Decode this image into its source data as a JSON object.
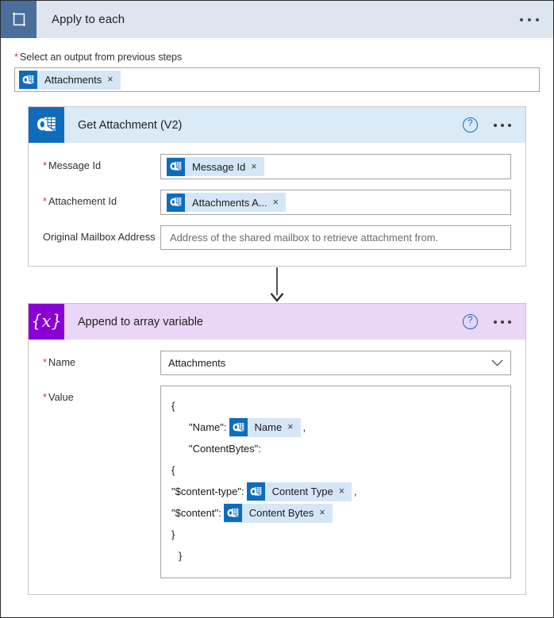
{
  "loop": {
    "title": "Apply to each",
    "icon": "loop-icon",
    "menu_icon": "ellipsis-icon",
    "output_field": {
      "label": "Select an output from previous steps",
      "required_marker": "*",
      "token": {
        "label": "Attachments",
        "icon": "outlook-icon",
        "remove": "×"
      }
    }
  },
  "get_attachment_card": {
    "title": "Get Attachment (V2)",
    "icon": "outlook-icon",
    "help_label": "?",
    "menu_icon": "ellipsis-icon",
    "fields": [
      {
        "label": "Message Id",
        "required_marker": "*",
        "token": {
          "label": "Message Id",
          "icon": "outlook-icon",
          "remove": "×"
        }
      },
      {
        "label": "Attachement Id",
        "required_marker": "*",
        "token": {
          "label": "Attachments A...",
          "icon": "outlook-icon",
          "remove": "×"
        }
      },
      {
        "label": "Original Mailbox Address",
        "required_marker": "",
        "placeholder": "Address of the shared mailbox to retrieve attachment from.",
        "value": ""
      }
    ]
  },
  "connector": {
    "icon": "down-arrow-icon"
  },
  "append_card": {
    "title": "Append to array variable",
    "icon": "variable-icon",
    "icon_glyph": "{x}",
    "help_label": "?",
    "menu_icon": "ellipsis-icon",
    "name_field": {
      "label": "Name",
      "required_marker": "*",
      "value": "Attachments",
      "chevron_icon": "chevron-down-icon"
    },
    "value_field": {
      "label": "Value",
      "required_marker": "*",
      "lines": [
        {
          "indent": 0,
          "before": "{",
          "token": null,
          "after": ""
        },
        {
          "indent": 1,
          "before": "\"Name\":",
          "token": {
            "label": "Name",
            "icon": "outlook-icon",
            "remove": "×"
          },
          "after": ","
        },
        {
          "indent": 1,
          "before": "\"ContentBytes\":",
          "token": null,
          "after": ""
        },
        {
          "indent": 0,
          "before": "{",
          "token": null,
          "after": ""
        },
        {
          "indent": 0,
          "before": "\"$content-type\":",
          "token": {
            "label": "Content Type",
            "icon": "outlook-icon",
            "remove": "×"
          },
          "after": ","
        },
        {
          "indent": 0,
          "before": "\"$content\":",
          "token": {
            "label": "Content Bytes",
            "icon": "outlook-icon",
            "remove": "×"
          },
          "after": ""
        },
        {
          "indent": 0,
          "before": "}",
          "token": null,
          "after": ""
        },
        {
          "indent": 0,
          "before": " }",
          "token": null,
          "after": ""
        }
      ]
    }
  },
  "colors": {
    "loop_header_bg": "#dee5ef",
    "loop_icon_bg": "#4a6f9b",
    "outlook_blue": "#0f6cbd",
    "outlook_header_bg": "#daeaf7",
    "variable_purple": "#8a00d4",
    "variable_header_bg": "#ead6f7",
    "token_chip_bg": "#d5e7f7",
    "required_red": "#d13438",
    "help_blue": "#1268c3"
  }
}
